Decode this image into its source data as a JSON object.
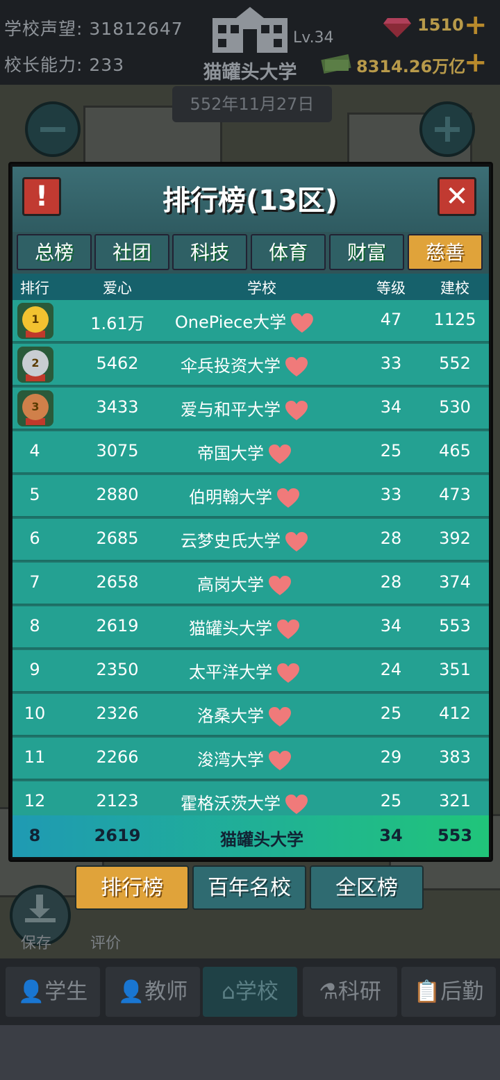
{
  "topbar": {
    "reputation_label": "学校声望:",
    "reputation_value": "31812647",
    "ability_label": "校长能力:",
    "ability_value": "233",
    "school_name": "猫罐头大学",
    "level": "Lv.34",
    "gems": "1510",
    "money": "8314.26万亿",
    "date": "552年11月27日"
  },
  "panel": {
    "title": "排行榜(13区)",
    "alert_glyph": "!",
    "close_glyph": "✕"
  },
  "tabs": [
    {
      "label": "总榜",
      "active": false
    },
    {
      "label": "社团",
      "active": false
    },
    {
      "label": "科技",
      "active": false
    },
    {
      "label": "体育",
      "active": false
    },
    {
      "label": "财富",
      "active": false
    },
    {
      "label": "慈善",
      "active": true
    }
  ],
  "columns": {
    "rank": "排行",
    "love": "爱心",
    "school": "学校",
    "level": "等级",
    "founded": "建校"
  },
  "rows": [
    {
      "rank": "1",
      "love": "1.61万",
      "school": "OnePiece大学",
      "level": "47",
      "founded": "1125"
    },
    {
      "rank": "2",
      "love": "5462",
      "school": "伞兵投资大学",
      "level": "33",
      "founded": "552"
    },
    {
      "rank": "3",
      "love": "3433",
      "school": "爱与和平大学",
      "level": "34",
      "founded": "530"
    },
    {
      "rank": "4",
      "love": "3075",
      "school": "帝国大学",
      "level": "25",
      "founded": "465"
    },
    {
      "rank": "5",
      "love": "2880",
      "school": "伯明翰大学",
      "level": "33",
      "founded": "473"
    },
    {
      "rank": "6",
      "love": "2685",
      "school": "云梦史氏大学",
      "level": "28",
      "founded": "392"
    },
    {
      "rank": "7",
      "love": "2658",
      "school": "高岗大学",
      "level": "28",
      "founded": "374"
    },
    {
      "rank": "8",
      "love": "2619",
      "school": "猫罐头大学",
      "level": "34",
      "founded": "553"
    },
    {
      "rank": "9",
      "love": "2350",
      "school": "太平洋大学",
      "level": "24",
      "founded": "351"
    },
    {
      "rank": "10",
      "love": "2326",
      "school": "洛桑大学",
      "level": "25",
      "founded": "412"
    },
    {
      "rank": "11",
      "love": "2266",
      "school": "浚湾大学",
      "level": "29",
      "founded": "383"
    },
    {
      "rank": "12",
      "love": "2123",
      "school": "霍格沃茨大学",
      "level": "25",
      "founded": "321"
    }
  ],
  "my_row": {
    "rank": "8",
    "love": "2619",
    "school": "猫罐头大学",
    "level": "34",
    "founded": "553"
  },
  "bottom_tabs": [
    {
      "label": "排行榜",
      "active": true
    },
    {
      "label": "百年名校",
      "active": false
    },
    {
      "label": "全区榜",
      "active": false
    }
  ],
  "side": {
    "save": "保存",
    "rate": "评价"
  },
  "nav": [
    {
      "label": "学生",
      "icon": "student-icon",
      "active": false
    },
    {
      "label": "教师",
      "icon": "teacher-icon",
      "active": false
    },
    {
      "label": "学校",
      "icon": "school-icon",
      "active": true
    },
    {
      "label": "科研",
      "icon": "flask-icon",
      "active": false
    },
    {
      "label": "后勤",
      "icon": "clipboard-icon",
      "active": false
    }
  ],
  "colors": {
    "accent": "#e0a33a",
    "row": "#24a192",
    "header": "#16616b",
    "heart": "#f07a7a"
  }
}
